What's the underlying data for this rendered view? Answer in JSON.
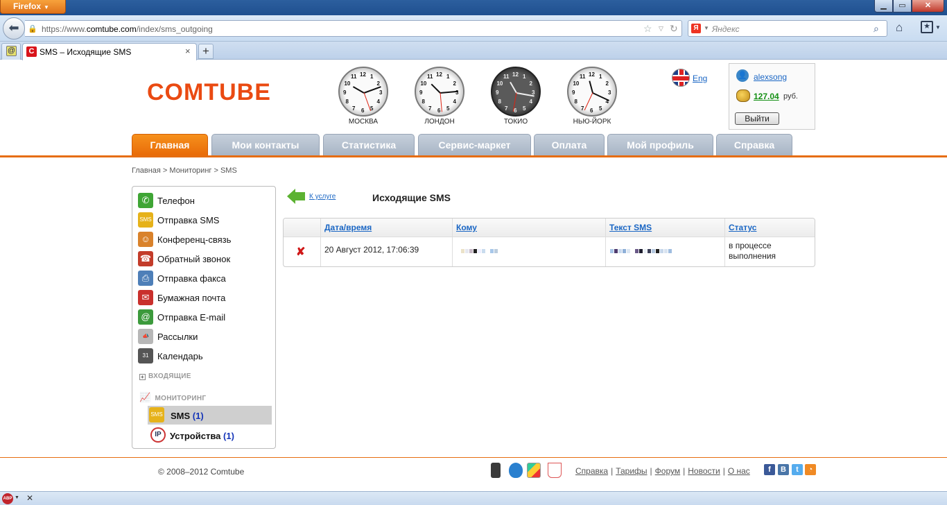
{
  "browser": {
    "menu_button": "Firefox",
    "url_prefix": "https://www.",
    "url_domain": "comtube.com",
    "url_path": "/index/sms_outgoing",
    "search_placeholder": "Яндекс",
    "search_engine_letter": "Я",
    "tab_title": "SMS – Исходящие SMS",
    "tab_favicon_letter": "C",
    "new_tab": "+",
    "tab_close": "×"
  },
  "header": {
    "logo": "COMTUBE",
    "clocks": [
      {
        "label": "МОСКВА",
        "dark": false
      },
      {
        "label": "ЛОНДОН",
        "dark": false
      },
      {
        "label": "ТОКИО",
        "dark": true
      },
      {
        "label": "НЬЮ-ЙОРК",
        "dark": false
      }
    ],
    "lang_link": "Eng"
  },
  "user": {
    "name": "alexsong",
    "balance": "127.04",
    "currency": "руб.",
    "logout": "Выйти"
  },
  "nav": {
    "tabs": [
      "Главная",
      "Мои контакты",
      "Статистика",
      "Сервис-маркет",
      "Оплата",
      "Мой профиль",
      "Справка"
    ]
  },
  "breadcrumb": "Главная > Мониторинг > SMS",
  "sidebar": {
    "items": [
      {
        "label": "Телефон",
        "icon": "phone-icon",
        "color": "#3fa535"
      },
      {
        "label": "Отправка SMS",
        "icon": "sms-icon",
        "color": "#e6b21a"
      },
      {
        "label": "Конференц-связь",
        "icon": "conference-icon",
        "color": "#d9822b"
      },
      {
        "label": "Обратный звонок",
        "icon": "callback-icon",
        "color": "#c33c2a"
      },
      {
        "label": "Отправка факса",
        "icon": "fax-icon",
        "color": "#4e7fb8"
      },
      {
        "label": "Бумажная почта",
        "icon": "mail-icon",
        "color": "#c9302c"
      },
      {
        "label": "Отправка E-mail",
        "icon": "email-icon",
        "color": "#3c9a3c"
      },
      {
        "label": "Рассылки",
        "icon": "megaphone-icon",
        "color": "#b7b7b7"
      },
      {
        "label": "Календарь",
        "icon": "calendar-icon",
        "color": "#555555"
      }
    ],
    "section_incoming": "ВХОДЯЩИЕ",
    "section_monitoring": "МОНИТОРИНГ",
    "sub_sms_label": "SMS",
    "sub_sms_count": "(1)",
    "sub_devices_label": "Устройства",
    "sub_devices_count": "(1)"
  },
  "content": {
    "back_link": "К услуге",
    "title": "Исходящие SMS",
    "columns": [
      "Дата/время",
      "Кому",
      "Текст SMS",
      "Статус"
    ],
    "rows": [
      {
        "datetime": "20 Август 2012, 17:06:39",
        "status": "в процессе выполнения"
      }
    ]
  },
  "footer": {
    "copyright": "© 2008–2012 Comtube",
    "links": [
      "Справка",
      "Тарифы",
      "Форум",
      "Новости",
      "О нас"
    ]
  },
  "statusbar": {
    "adblock": "ABP"
  }
}
